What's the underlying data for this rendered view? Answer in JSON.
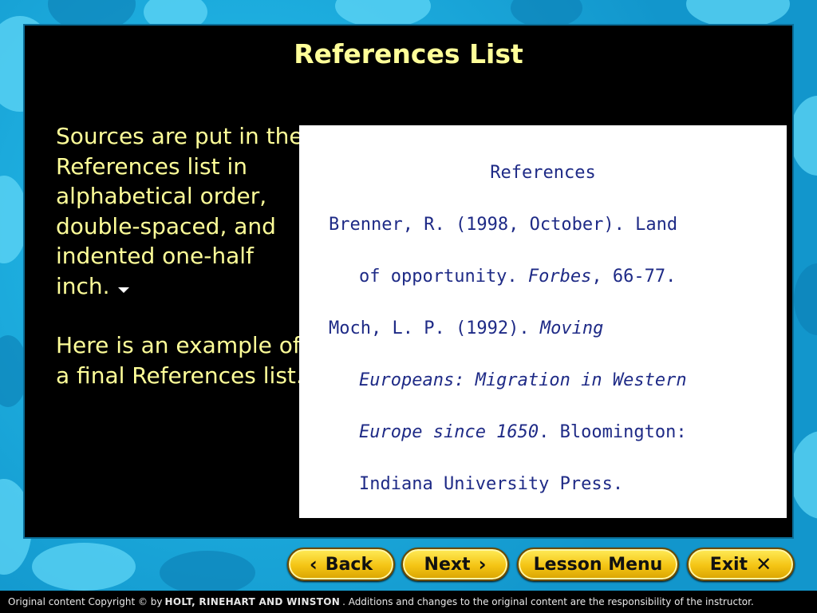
{
  "slide": {
    "title": "References List",
    "left_paragraph_1": "Sources are put in the References list in alphabetical order, double-spaced, and indented one-half inch.",
    "left_paragraph_2": "Here is an example of a final References list.",
    "arrow_icon": "down-arrow-icon"
  },
  "references": {
    "heading": "References",
    "entry1_line1": "Brenner, R. (1998, October). Land",
    "entry1_line2_a": "of opportunity. ",
    "entry1_line2_italic": "Forbes",
    "entry1_line2_b": ", 66-77.",
    "entry2_line1_a": "Moch, L. P. (1992). ",
    "entry2_line1_italic": "Moving",
    "entry2_line2_italic": "Europeans: Migration in Western",
    "entry2_line3_italic": "Europe since 1650",
    "entry2_line3_b": ". Bloomington:",
    "entry2_line4": "Indiana University Press."
  },
  "nav": {
    "back_label": "Back",
    "next_label": "Next",
    "lesson_menu_label": "Lesson Menu",
    "exit_label": "Exit"
  },
  "footer": {
    "prefix": "Original content Copyright © by",
    "publisher": "HOLT, RINEHART AND WINSTON",
    "suffix": ". Additions and changes to the original content are the responsibility of the instructor."
  },
  "colors": {
    "title_text": "#ffff99",
    "reference_text": "#1e2a86",
    "button_fill": "#f4c414",
    "background": "#1aa8d8"
  }
}
